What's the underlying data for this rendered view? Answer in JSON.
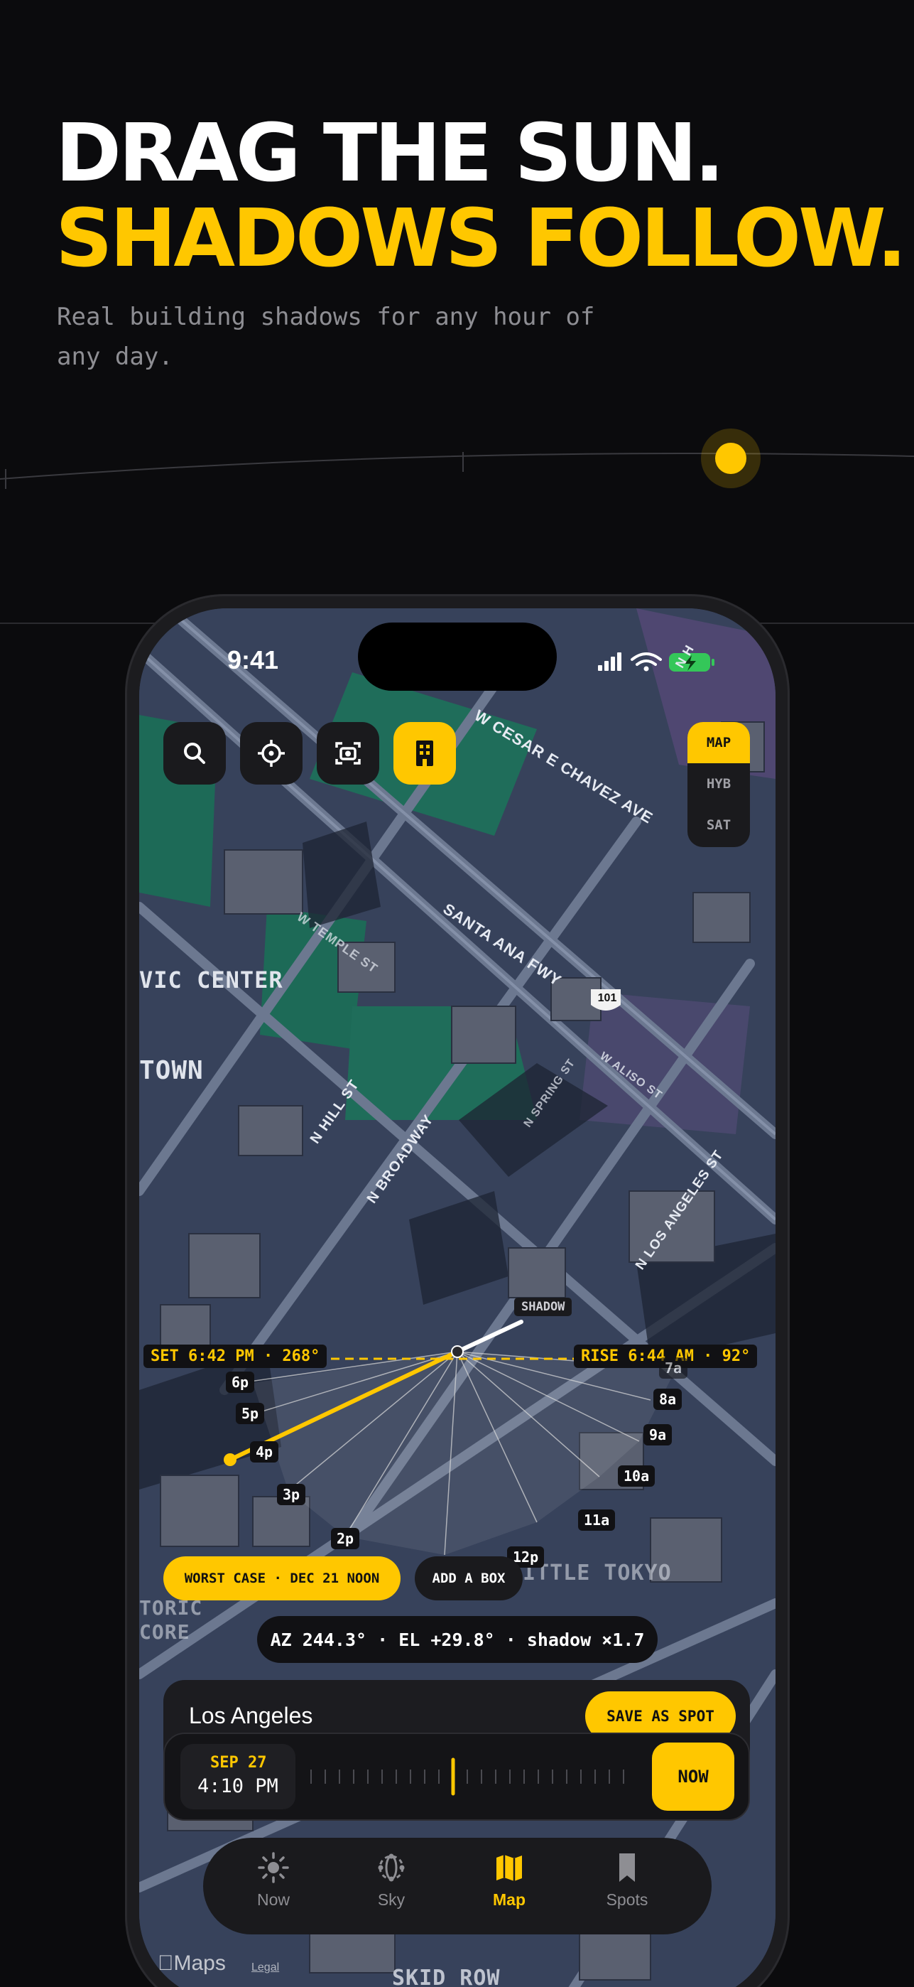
{
  "hero": {
    "line1": "DRAG THE SUN.",
    "line2": "SHADOWS FOLLOW.",
    "subtitle": "Real building shadows for any hour of any day."
  },
  "colors": {
    "accent": "#ffc700",
    "background": "#0b0b0d",
    "panel": "#1a1a1d"
  },
  "status_bar": {
    "time": "9:41"
  },
  "toolbar": {
    "buttons": [
      "search-icon",
      "locate-crosshair-icon",
      "camera-icon",
      "buildings-icon"
    ],
    "active": "buildings-icon"
  },
  "map_type": {
    "options": [
      "MAP",
      "HYB",
      "SAT"
    ],
    "selected": "MAP"
  },
  "map": {
    "place_labels": [
      "VIC CENTER",
      "TOWN",
      "ITTLE TOKYO",
      "TORIC",
      "CORE",
      "SKID ROW"
    ],
    "streets": [
      "W CESAR E CHAVEZ AVE",
      "SANTA ANA FWY",
      "W TEMPLE ST",
      "N HILL ST",
      "N BROADWAY",
      "N SPRING ST",
      "W ALISO ST",
      "N LOS ANGELES ST",
      "N H"
    ],
    "highway_shield": "101",
    "attribution": "Maps",
    "legal": "Legal"
  },
  "sun_dial": {
    "shadow_tag": "SHADOW",
    "set_label": "SET 6:42 PM · 268°",
    "rise_label": "RISE 6:44 AM · 92°",
    "hour_markers": [
      "6p",
      "5p",
      "4p",
      "3p",
      "2p",
      "12p",
      "11a",
      "10a",
      "9a",
      "8a",
      "7a"
    ]
  },
  "actions": {
    "worst_case": "WORST CASE · DEC 21 NOON",
    "add_box": "ADD A BOX"
  },
  "readout": "AZ 244.3° · EL +29.8° · shadow ×1.7",
  "location": {
    "name": "Los Angeles",
    "save_button": "SAVE AS SPOT"
  },
  "time_control": {
    "date": "SEP 27",
    "time": "4:10 PM",
    "now_button": "NOW"
  },
  "tabs": [
    {
      "label": "Now",
      "icon": "sun-icon"
    },
    {
      "label": "Sky",
      "icon": "sky-dome-icon"
    },
    {
      "label": "Map",
      "icon": "map-icon"
    },
    {
      "label": "Spots",
      "icon": "bookmark-icon"
    }
  ],
  "active_tab": "Map"
}
